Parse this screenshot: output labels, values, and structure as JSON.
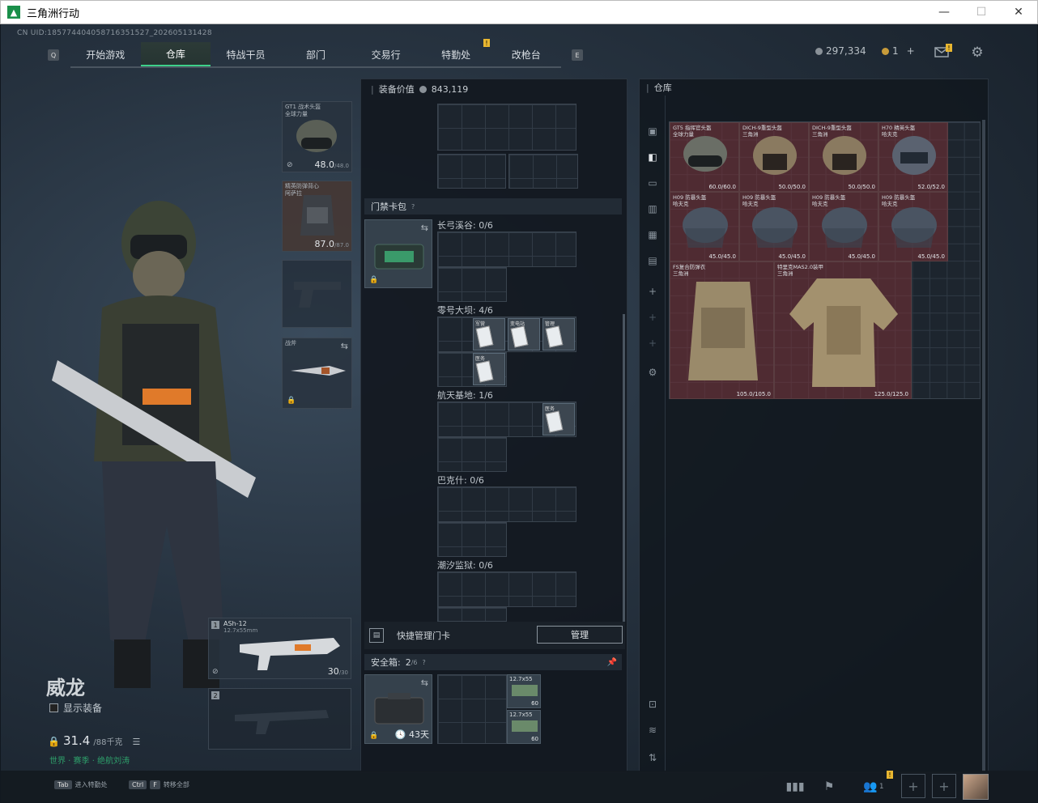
{
  "window": {
    "title": "三角洲行动",
    "min": "—",
    "max": "☐",
    "close": "✕"
  },
  "uid": "CN UID:185774404058716351527_202605131428",
  "nav": {
    "tabs": [
      {
        "label": "开始游戏",
        "active": false
      },
      {
        "label": "仓库",
        "active": true
      },
      {
        "label": "特战干员",
        "active": false
      },
      {
        "label": "部门",
        "active": false
      },
      {
        "label": "交易行",
        "active": false
      },
      {
        "label": "特勤处",
        "active": false,
        "badge": "!"
      },
      {
        "label": "改枪台",
        "active": false
      }
    ],
    "left_key": "Q",
    "right_key": "E"
  },
  "currency": {
    "coins": "297,334",
    "tickets": "1",
    "plus": "+"
  },
  "operator": {
    "name": "威龙",
    "show_equipment": "显示装备",
    "weight": "31.4",
    "weight_max": "/88千克",
    "season_text": "世界 · 赛季 · 绝航刘涛"
  },
  "slots": {
    "helmet": {
      "name": "GT1 战术头盔\n全球力量",
      "value": "48.0",
      "max": "/48.0"
    },
    "armor": {
      "name": "精英防弹背心\n阿萨拉",
      "value": "87.0",
      "max": "/87.0"
    },
    "melee": {
      "name": "战斧",
      "tag": ""
    },
    "primary": {
      "tag": "1",
      "name": "ASh-12",
      "caliber": "12.7x55mm",
      "ammo": "30",
      "ammo_max": "/30"
    },
    "secondary": {
      "tag": "2"
    }
  },
  "middle": {
    "header": "装备价值",
    "value": "843,119",
    "cardpack": "门禁卡包",
    "help": "?",
    "areas": [
      {
        "label": "长弓溪谷: 0/6"
      },
      {
        "label": "零号大坝: 4/6"
      },
      {
        "label": "航天基地: 1/6"
      },
      {
        "label": "巴克什: 0/6"
      },
      {
        "label": "潮汐监狱: 0/6"
      }
    ],
    "cards_dam": [
      "军营",
      "变电站",
      "管理",
      "医务"
    ],
    "cards_space": [
      "医务"
    ],
    "quick_manage": "快捷管理门卡",
    "manage_btn": "管理",
    "safebox": "安全箱:",
    "safebox_count": "2",
    "safebox_max": "/6",
    "safebox_days": "43天",
    "ammo": [
      {
        "name": "12.7x55",
        "count": "60"
      },
      {
        "name": "12.7x55",
        "count": "60"
      }
    ]
  },
  "stash": {
    "title": "仓库",
    "items": [
      {
        "name": "GT5 指挥官头盔\n全球力量",
        "val": "60.0/60.0"
      },
      {
        "name": "DICH-9重型头盔\n三角洲",
        "val": "50.0/50.0"
      },
      {
        "name": "DICH-9重型头盔\n三角洲",
        "val": "50.0/50.0"
      },
      {
        "name": "H70 精英头盔\n哈夫克",
        "val": "52.0/52.0"
      },
      {
        "name": "H09 防暴头盔\n哈夫克",
        "val": "45.0/45.0"
      },
      {
        "name": "H09 防暴头盔\n哈夫克",
        "val": "45.0/45.0"
      },
      {
        "name": "H09 防暴头盔\n哈夫克",
        "val": "45.0/45.0"
      },
      {
        "name": "H09 防暴头盔\n哈夫克",
        "val": "45.0/45.0"
      },
      {
        "name": "FS复合防弹衣\n三角洲",
        "val": "105.0/105.0"
      },
      {
        "name": "特里克MAS2.0装甲\n三角洲",
        "val": "125.0/125.0"
      }
    ]
  },
  "bottom": {
    "tab_key": "Tab",
    "tab_label": "进入特勤处",
    "ctrl_key": "Ctrl",
    "f_key": "F",
    "ctrl_label": "转移全部",
    "friends": "1",
    "badge": "!"
  }
}
